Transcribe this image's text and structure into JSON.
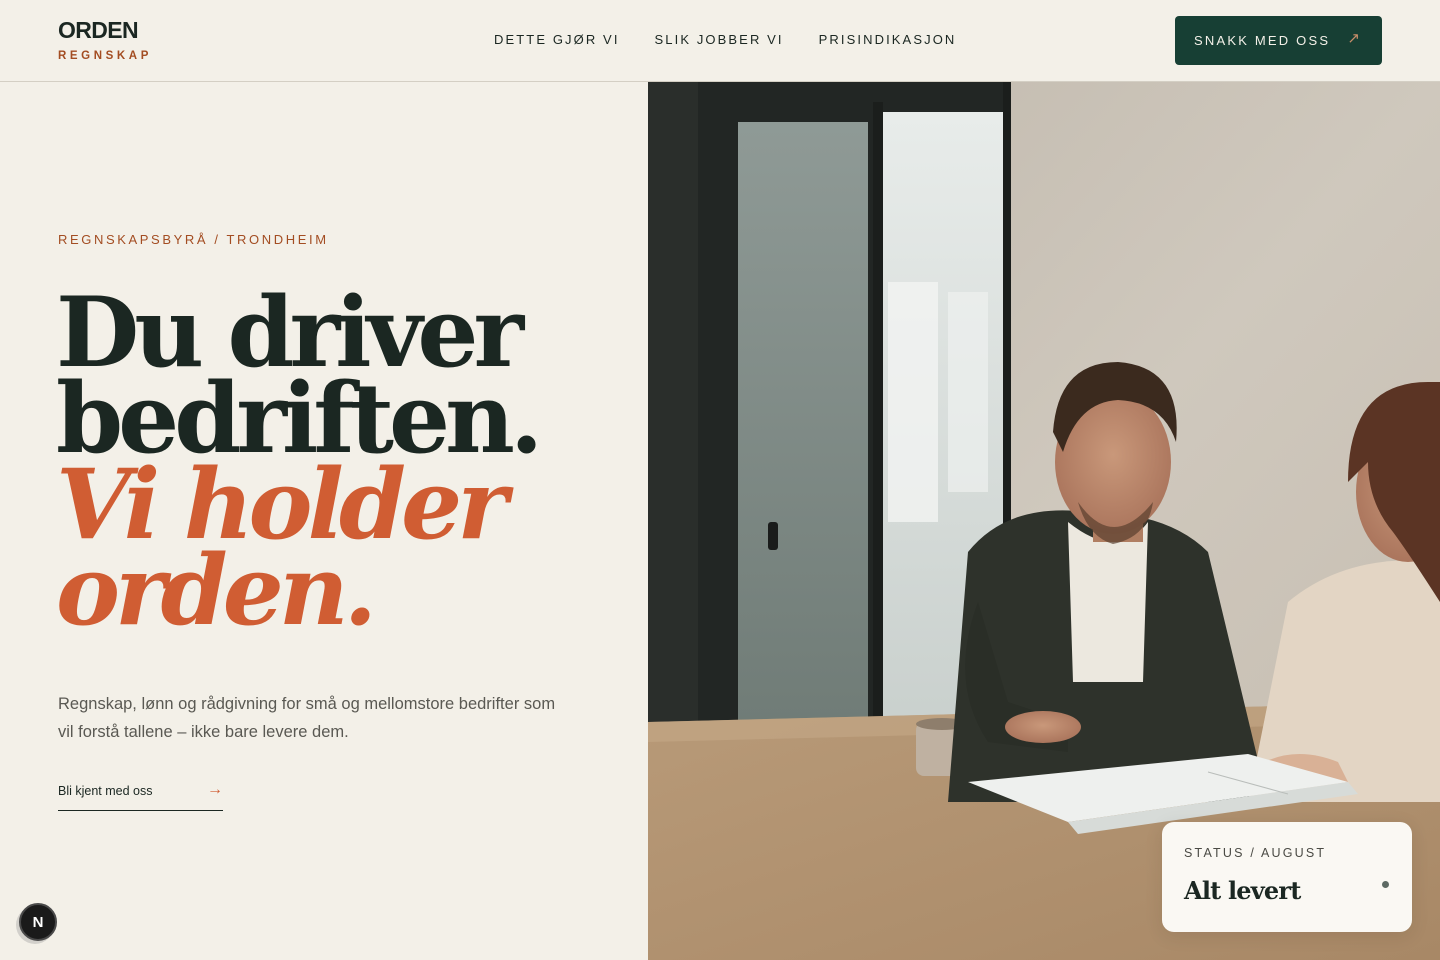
{
  "brand": {
    "name": "ORDEN",
    "tagline": "REGNSKAP"
  },
  "nav": {
    "items": [
      {
        "label": "DETTE GJØR VI"
      },
      {
        "label": "SLIK JOBBER VI"
      },
      {
        "label": "PRISINDIKASJON"
      }
    ]
  },
  "cta": {
    "label": "SNAKK MED OSS",
    "icon": "↗"
  },
  "hero": {
    "eyebrow": "REGNSKAPSBYRÅ / TRONDHEIM",
    "headline": {
      "line1": "Du driver",
      "line2": "bedriften.",
      "line3": "Vi holder",
      "line4": "orden."
    },
    "lede": "Regnskap, lønn og rådgivning for små og mellomstore bedrifter som vil forstå tallene – ikke bare levere dem.",
    "link_label": "Bli kjent med oss",
    "link_arrow": "→"
  },
  "status": {
    "label": "STATUS / AUGUST",
    "value": "Alt levert"
  },
  "floating_badge": {
    "letter": "N"
  },
  "colors": {
    "background": "#f3f0e8",
    "ink": "#1b2722",
    "accent": "#d05d33",
    "rust": "#a34d22",
    "cta_bg": "#173f34"
  }
}
